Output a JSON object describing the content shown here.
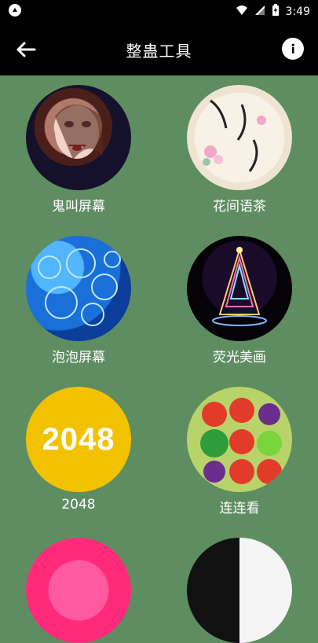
{
  "status_bar": {
    "time": "3:49",
    "icons": [
      "notification-icon",
      "wifi-icon",
      "cellular-icon",
      "battery-charging-icon"
    ]
  },
  "app_bar": {
    "title": "整蛊工具",
    "back_icon": "back-arrow-icon",
    "info_icon": "info-icon"
  },
  "tools": [
    {
      "label": "鬼叫屏幕",
      "image": "vampire-face"
    },
    {
      "label": "花间语茶",
      "image": "flower-tea-calligraphy"
    },
    {
      "label": "泡泡屏幕",
      "image": "blue-bubbles"
    },
    {
      "label": "荧光美画",
      "image": "glowing-tree"
    },
    {
      "label": "2048",
      "image": "2048-logo",
      "logo_text": "2048"
    },
    {
      "label": "连连看",
      "image": "fruit-match"
    }
  ],
  "partial_tiles": [
    {
      "image": "pink-circle"
    },
    {
      "image": "black-white-circle"
    }
  ],
  "colors": {
    "background": "#5f8d62",
    "bars": "#000000",
    "text": "#ffffff"
  }
}
